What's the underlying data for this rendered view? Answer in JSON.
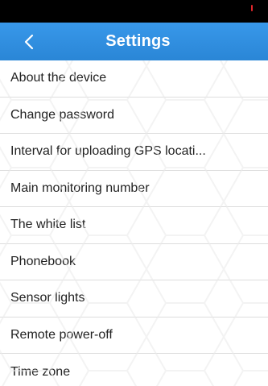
{
  "header": {
    "title": "Settings",
    "back_icon": "chevron-left-icon",
    "color": "#2f8ee0"
  },
  "settings": {
    "items": [
      {
        "label": "About the device"
      },
      {
        "label": "Change password"
      },
      {
        "label": "Interval for uploading GPS locati..."
      },
      {
        "label": "Main monitoring number"
      },
      {
        "label": "The white list"
      },
      {
        "label": "Phonebook"
      },
      {
        "label": "Sensor lights"
      },
      {
        "label": "Remote power-off"
      },
      {
        "label": "Time zone"
      }
    ]
  }
}
